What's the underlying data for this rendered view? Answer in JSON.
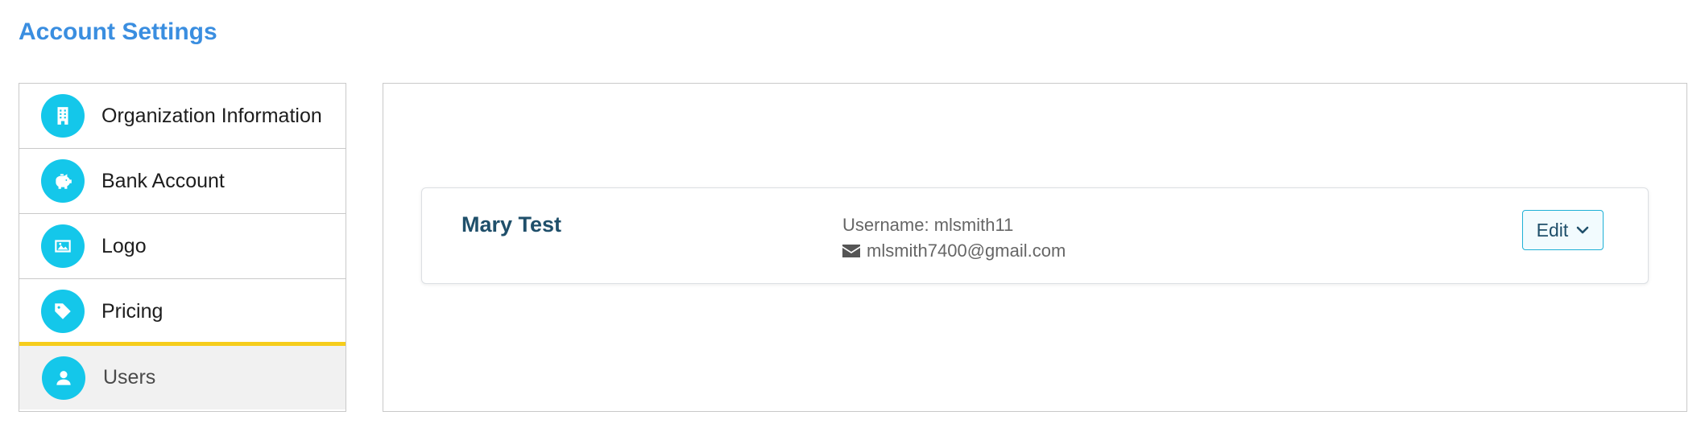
{
  "page": {
    "title": "Account Settings"
  },
  "sidebar": {
    "items": [
      {
        "label": "Organization Information",
        "icon": "building-icon"
      },
      {
        "label": "Bank Account",
        "icon": "piggy-bank-icon"
      },
      {
        "label": "Logo",
        "icon": "image-icon"
      },
      {
        "label": "Pricing",
        "icon": "tag-icon"
      },
      {
        "label": "Users",
        "icon": "user-icon",
        "active": true
      }
    ]
  },
  "user": {
    "name": "Mary Test",
    "username": "Username: mlsmith11",
    "email": "mlsmith7400@gmail.com",
    "edit_label": "Edit"
  },
  "colors": {
    "title": "#3a8ee0",
    "icon_bg": "#14c7ea",
    "active_indicator": "#f6cd1c",
    "name": "#1f4f6a"
  }
}
